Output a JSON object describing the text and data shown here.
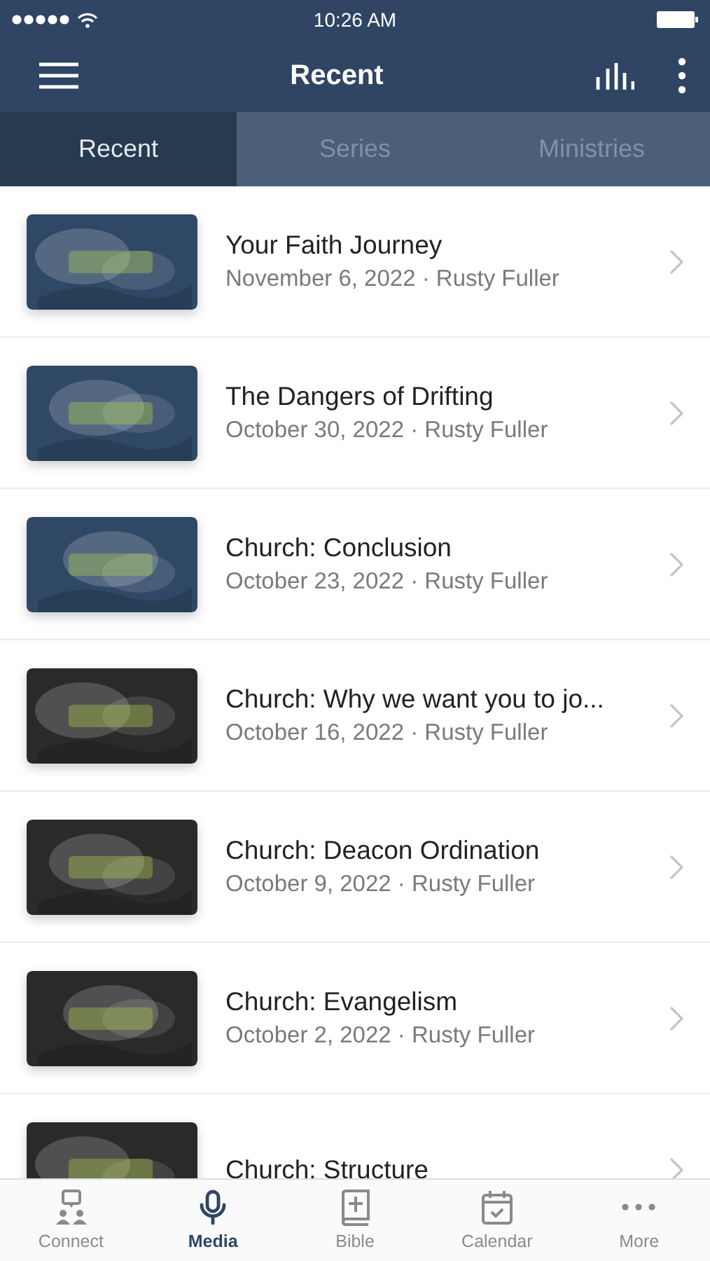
{
  "status_bar": {
    "time": "10:26 AM"
  },
  "header": {
    "title": "Recent"
  },
  "tabs": [
    {
      "label": "Recent",
      "selected": true
    },
    {
      "label": "Series",
      "selected": false
    },
    {
      "label": "Ministries",
      "selected": false
    }
  ],
  "items": [
    {
      "title": "Your Faith Journey",
      "subtitle": "November 6, 2022 · Rusty Fuller"
    },
    {
      "title": "The Dangers of Drifting",
      "subtitle": "October 30, 2022 · Rusty Fuller"
    },
    {
      "title": "Church: Conclusion",
      "subtitle": "October 23, 2022 · Rusty Fuller"
    },
    {
      "title": "Church: Why we want you to jo...",
      "subtitle": "October 16, 2022 · Rusty Fuller"
    },
    {
      "title": "Church: Deacon Ordination",
      "subtitle": "October 9, 2022 · Rusty Fuller"
    },
    {
      "title": "Church: Evangelism",
      "subtitle": "October 2, 2022 · Rusty Fuller"
    },
    {
      "title": "Church: Structure"
    }
  ],
  "tab_bar": [
    {
      "label": "Connect",
      "kind": "connect",
      "selected": false
    },
    {
      "label": "Media",
      "kind": "media",
      "selected": true
    },
    {
      "label": "Bible",
      "kind": "bible",
      "selected": false
    },
    {
      "label": "Calendar",
      "kind": "calendar",
      "selected": false
    },
    {
      "label": "More",
      "kind": "more",
      "selected": false
    }
  ]
}
